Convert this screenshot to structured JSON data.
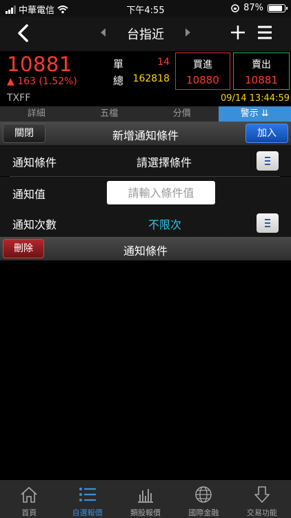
{
  "status_bar": {
    "carrier": "中華電信",
    "time": "下午4:55",
    "battery": "87%",
    "battery_level": 0.87
  },
  "nav": {
    "title": "台指近"
  },
  "quote": {
    "price": "10881",
    "change": "▲ 163 (1.52%)",
    "symbol": "TXFF",
    "single_label": "單",
    "single_value": "14",
    "total_label": "總",
    "total_value": "162818",
    "buy_label": "買進",
    "buy_value": "10880",
    "sell_label": "賣出",
    "sell_value": "10881",
    "timestamp": "09/14 13:44:59"
  },
  "tabs": [
    {
      "label": "詳細"
    },
    {
      "label": "五檔"
    },
    {
      "label": "分價"
    },
    {
      "label": "警示 ⇊",
      "active": true
    }
  ],
  "form": {
    "close_label": "關閉",
    "title": "新增通知條件",
    "add_label": "加入",
    "condition_label": "通知條件",
    "condition_value": "請選擇條件",
    "value_label": "通知值",
    "value_placeholder": "請輸入條件值",
    "count_label": "通知次數",
    "count_value": "不限次"
  },
  "list": {
    "delete_label": "刪除",
    "title": "通知條件"
  },
  "bottom_nav": [
    {
      "label": "首頁",
      "icon": "home-icon"
    },
    {
      "label": "自選報價",
      "icon": "list-icon",
      "active": true
    },
    {
      "label": "類股報價",
      "icon": "bar-chart-icon"
    },
    {
      "label": "國際金融",
      "icon": "globe-icon"
    },
    {
      "label": "交易功能",
      "icon": "trade-arrow-icon"
    }
  ],
  "colors": {
    "up_red": "#ff3b30",
    "accent_blue": "#3b8fd8",
    "yellow": "#ffd60a",
    "cyan": "#35c3e8"
  }
}
